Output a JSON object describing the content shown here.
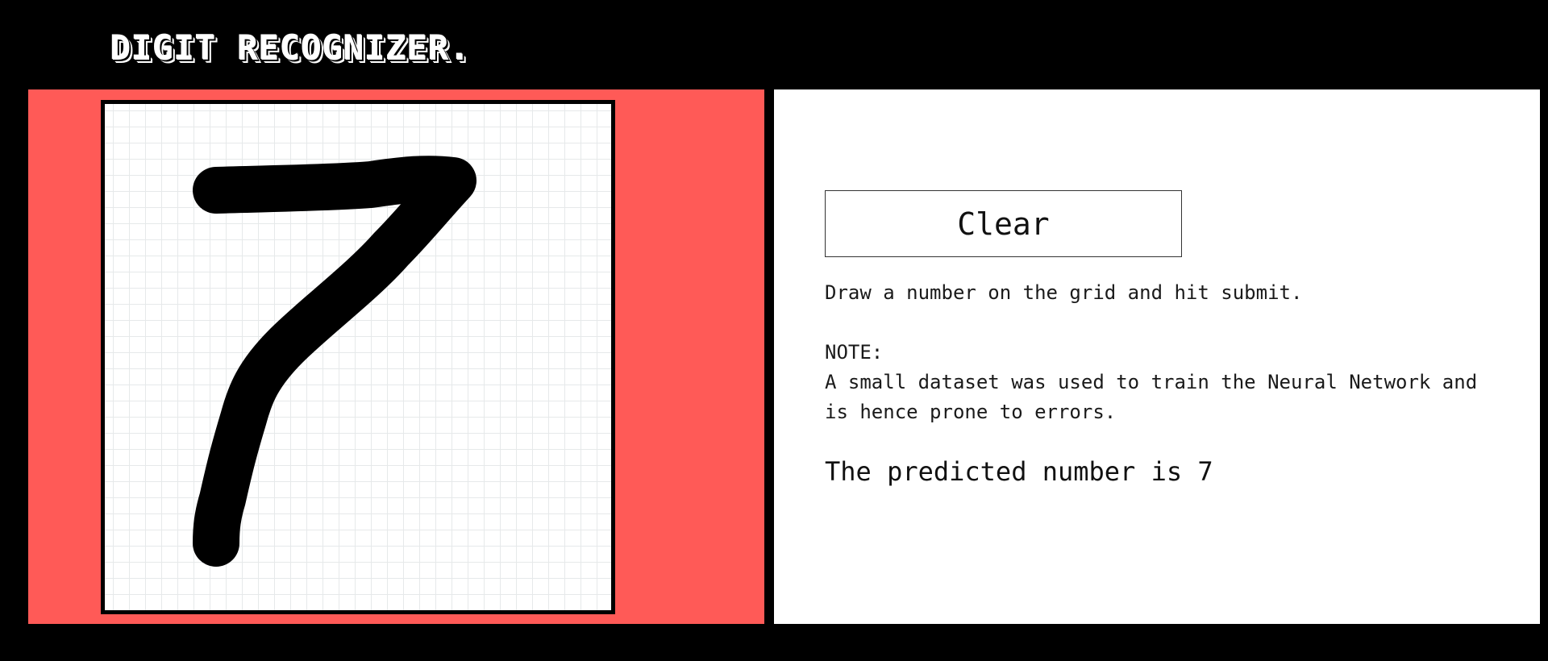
{
  "header": {
    "title": "DIGIT RECOGNIZER."
  },
  "canvas": {
    "drawn_digit": "7",
    "stroke_color": "#000000",
    "grid_color": "#e6e9ea",
    "panel_color": "#ff5a57"
  },
  "controls": {
    "clear_label": "Clear"
  },
  "instructions": {
    "text": "Draw a number on the grid and hit submit."
  },
  "note": {
    "heading": "NOTE:",
    "body": "A small dataset was used to train the Neural Network and is hence prone to errors."
  },
  "result": {
    "prediction_text": "The predicted number is 7"
  }
}
